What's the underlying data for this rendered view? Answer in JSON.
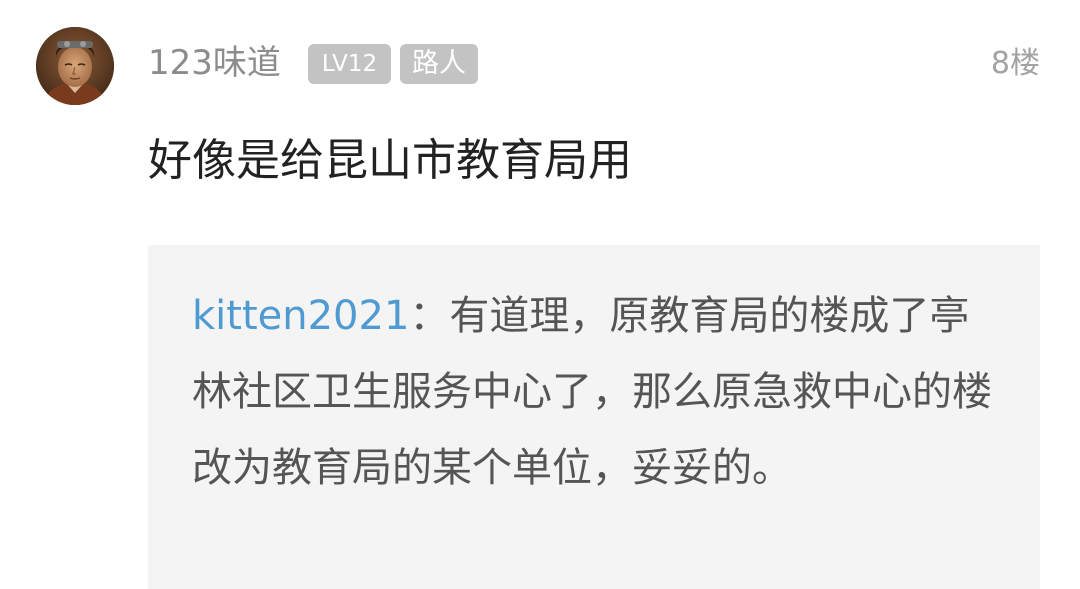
{
  "post": {
    "username": "123味道",
    "badges": {
      "level": "LV12",
      "role": "路人"
    },
    "floor": "8楼",
    "content": "好像是给昆山市教育局用",
    "quote": {
      "author": "kitten2021",
      "separator": "：",
      "text": "有道理，原教育局的楼成了亭林社区卫生服务中心了，那么原急救中心的楼改为教育局的某个单位，妥妥的。"
    }
  },
  "colors": {
    "username": "#8c8c8c",
    "badge_bg": "#c3c3c3",
    "floor": "#a3a3a3",
    "content": "#222222",
    "quote_bg": "#f4f4f4",
    "quote_author": "#4f9bd1",
    "quote_text": "#555555"
  }
}
